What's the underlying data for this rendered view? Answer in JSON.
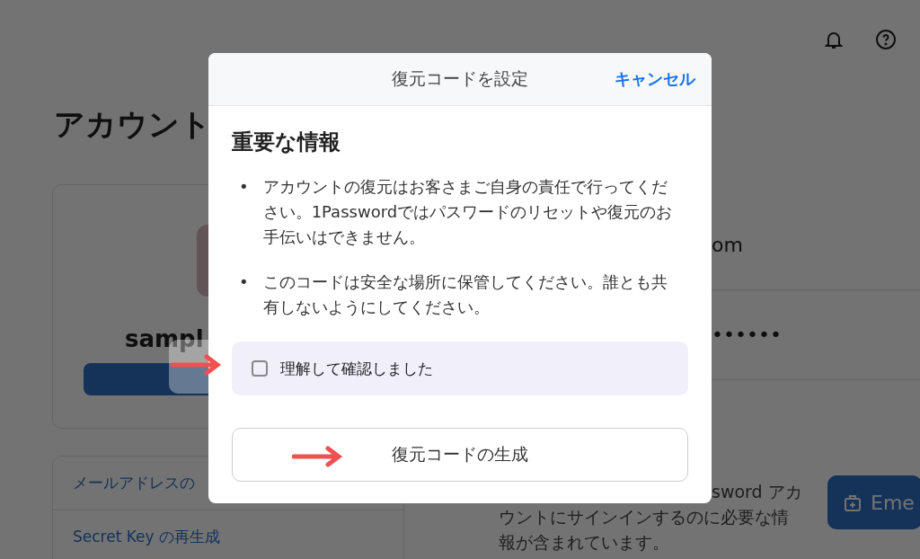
{
  "page": {
    "title": "アカウント",
    "account_name": "sampl",
    "email_tail": "om",
    "password_mask": "••••••",
    "kit_text_tail": "sword アカ",
    "kit_text_rest": "ウントにサインインするのに必要な情報が含まれています。",
    "kit_button": "Eme",
    "links": [
      "メールアドレスの",
      "Secret Key の再生成"
    ]
  },
  "dialog": {
    "title": "復元コードを設定",
    "cancel": "キャンセル",
    "heading": "重要な情報",
    "bullets": [
      {
        "marker": "•",
        "text": "アカウントの復元はお客さまご自身の責任で行ってください。1Passwordではパスワードのリセットや復元のお手伝いはできません。"
      },
      {
        "marker": "•",
        "text": "このコードは安全な場所に保管してください。誰とも共有しないようにしてください。"
      }
    ],
    "confirm": {
      "label": "理解して確認しました",
      "checked": false
    },
    "generate_button": "復元コードの生成"
  }
}
